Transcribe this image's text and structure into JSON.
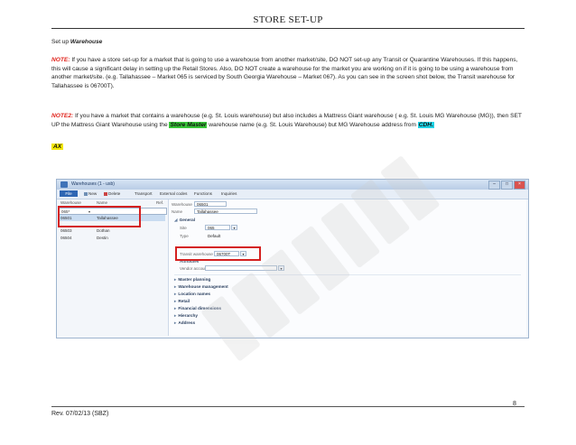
{
  "document": {
    "title": "STORE SET-UP",
    "heading_prefix": "Set up ",
    "heading_emph": "Warehouse",
    "note1_label": "NOTE:",
    "note1_text": " If you have a store set-up for a market that is going to use a warehouse from another market/site, DO NOT set-up any Transit or Quarantine Warehouses. If this happens, this will cause a significant delay in setting up the Retail Stores. Also, DO NOT create a warehouse for the market you are working on if it is going to be using a warehouse from another market/site. (e.g. Tallahassee – Market 065 is serviced by South Georgia Warehouse – Market 067). As you can see in the screen shot below, the Transit warehouse for Tallahassee is 06700T).",
    "note2_label": "NOTE2:",
    "note2_text_a": " If you have a market that contains a warehouse (e.g. St. Louis warehouse) but also includes a Mattress Giant warehouse ( e.g. St. Louis MG Warehouse (MG)), then SET UP the Mattress Giant Warehouse using the ",
    "note2_store_master": "Store Master",
    "note2_text_b": " warehouse name (e.g. St. Louis Warehouse) but MG Warehouse address from ",
    "note2_cdh": "CDH.",
    "ax_label": "AX",
    "page_number": "8",
    "revision": "Rev. 07/02/13 (SBZ)"
  },
  "screenshot": {
    "window_title": "Warehouses (1 - usb)",
    "window_buttons": [
      "–",
      "□",
      "×"
    ],
    "toolbar": {
      "file": "File",
      "new": "New",
      "delete": "Delete",
      "transport": "Transport",
      "external_codes": "External codes",
      "functions": "Functions",
      "inquiries": "Inquiries"
    },
    "list_headers": {
      "warehouse": "Warehouse",
      "name": "Name",
      "ref": "Ref."
    },
    "filter_row": {
      "warehouse": "065*",
      "name": ""
    },
    "rows": [
      {
        "warehouse": "06501",
        "name": "Tallahassee"
      },
      {
        "warehouse": "06503",
        "name": "Dothan"
      },
      {
        "warehouse": "06504",
        "name": "Destin"
      }
    ],
    "detail": {
      "warehouse_label": "Warehouse",
      "warehouse_value": "06501",
      "name_label": "Name",
      "name_value": "Tallahassee",
      "general_section": "General",
      "site_label": "Site",
      "site_value": "065",
      "type_label": "Type",
      "type_value": "Default",
      "transit_label": "Transit warehouse",
      "transit_value": "06700T",
      "attributes_label": "Attributes",
      "vendor_label": "Vendor account",
      "sections": [
        "Master planning",
        "Warehouse management",
        "Location names",
        "Retail",
        "Financial dimensions",
        "Hierarchy",
        "Address"
      ]
    }
  },
  "colors": {
    "note_red": "#e0241c",
    "store_master_green": "#39c639",
    "cdh_cyan": "#1fd3e6",
    "ax_yellow": "#f2e600",
    "callout_red": "#d42020"
  }
}
